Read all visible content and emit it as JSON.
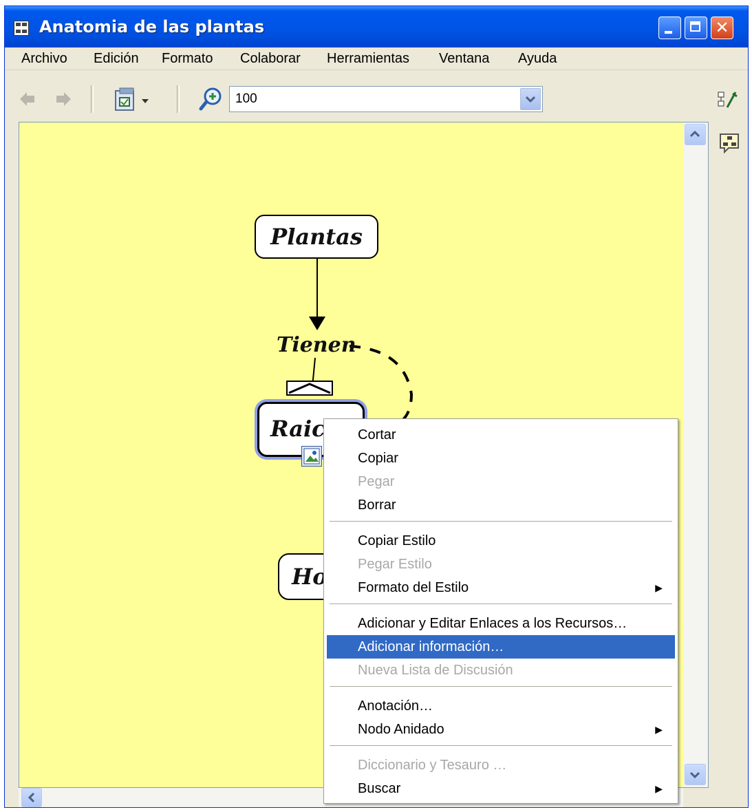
{
  "window": {
    "title": "Anatomia de las plantas",
    "title_bar_color": "#0054e3",
    "close_button_color": "#d8491f"
  },
  "menubar": {
    "items": [
      "Archivo",
      "Edición",
      "Formato",
      "Colaborar",
      "Herramientas",
      "Ventana",
      "Ayuda"
    ]
  },
  "toolbar": {
    "zoom_value": "100",
    "icons": [
      "back-arrow-icon",
      "forward-arrow-icon",
      "view-dropdown-icon",
      "zoom-icon",
      "combo-dropdown-icon",
      "style-palette-icon",
      "concept-map-icon"
    ]
  },
  "canvas": {
    "background": "#ffff99",
    "nodes": {
      "plantas": "Plantas",
      "raices": "Raices",
      "hojas": "Ho"
    },
    "link_label": "Tienen"
  },
  "context_menu": {
    "items": [
      {
        "label": "Cortar",
        "enabled": true
      },
      {
        "label": "Copiar",
        "enabled": true
      },
      {
        "label": "Pegar",
        "enabled": false
      },
      {
        "label": "Borrar",
        "enabled": true
      },
      {
        "label": "Copiar Estilo",
        "enabled": true
      },
      {
        "label": "Pegar Estilo",
        "enabled": false
      },
      {
        "label": "Formato del Estilo",
        "enabled": true,
        "submenu": true
      },
      {
        "label": "Adicionar y Editar Enlaces a los Recursos…",
        "enabled": true
      },
      {
        "label": "Adicionar información…",
        "enabled": true,
        "highlighted": true
      },
      {
        "label": "Nueva Lista de Discusión",
        "enabled": false
      },
      {
        "label": "Anotación…",
        "enabled": true
      },
      {
        "label": "Nodo Anidado",
        "enabled": true,
        "submenu": true
      },
      {
        "label": "Diccionario y Tesauro …",
        "enabled": false
      },
      {
        "label": "Buscar",
        "enabled": true,
        "submenu": true
      }
    ],
    "highlight_color": "#316ac5"
  }
}
